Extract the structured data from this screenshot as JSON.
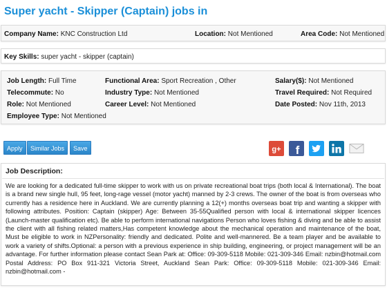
{
  "page_title": "Super yacht - Skipper (Captain) jobs in",
  "company": {
    "name_label": "Company Name:",
    "name_value": "KNC Construction Ltd",
    "location_label": "Location:",
    "location_value": "Not Mentioned",
    "area_code_label": "Area Code:",
    "area_code_value": "Not Mentioned"
  },
  "skills": {
    "label": "Key Skills:",
    "value": "super yacht - skipper (captain)"
  },
  "details": {
    "job_length": {
      "label": "Job Length:",
      "value": "Full Time"
    },
    "functional_area": {
      "label": "Functional Area:",
      "value": "Sport Recreation , Other"
    },
    "salary": {
      "label": "Salary($):",
      "value": "Not Mentioned"
    },
    "telecommute": {
      "label": "Telecommute:",
      "value": "No"
    },
    "industry_type": {
      "label": "Industry Type:",
      "value": "Not Mentioned"
    },
    "travel_required": {
      "label": "Travel Required:",
      "value": "Not Required"
    },
    "role": {
      "label": "Role:",
      "value": "Not Mentioned"
    },
    "career_level": {
      "label": "Career Level:",
      "value": "Not Mentioned"
    },
    "date_posted": {
      "label": "Date Posted:",
      "value": "Nov 11th, 2013"
    },
    "employee_type": {
      "label": "Employee Type:",
      "value": "Not Mentioned"
    }
  },
  "toolbar": {
    "apply_label": "Apply",
    "similar_jobs_label": "Similar Jobs",
    "save_label": "Save",
    "share_icons": [
      "google-plus-icon",
      "facebook-icon",
      "twitter-icon",
      "linkedin-icon",
      "email-icon"
    ],
    "colors": {
      "button": "#2b86c9",
      "google_plus": "#dd4b39",
      "facebook": "#3b5998",
      "twitter": "#1da1f2",
      "linkedin": "#0e76a8",
      "email": "#c8c8c8"
    }
  },
  "description": {
    "title": "Job Description:",
    "text": "We are looking for a dedicated full-time skipper to work with us on private recreational boat trips (both local & International). The boat is a brand new single hull, 95 feet, long-rage vessel (motor yacht) manned by 2-3 crews. The owner of the boat is from overseas who currently has a residence here in Auckland. We are currently planning a 12(+) months overseas boat trip and wanting a skipper with following attributes. Position: Captain (skipper) Age: Between 35-55Qualified person with local & international skipper licences (Launch-master qualification etc). Be able to perform international navigations Person who loves fishing & diving and be able to assist the client with all fishing related matters,Has competent knowledge about the mechanical operation and maintenance of the boat, Must be eligible to work in NZPersonality: friendly and dedicated. Polite and well-mannered. Be a team player and be available to work a variety of shifts.Optional: a person with a previous experience in ship building, engineering, or project management will be an advantage. For further information please contact Sean Park at: Office: 09-309-5118 Mobile: 021-309-346 Email: nzbin@hotmail.com Postal Address: PO Box 911-321 Victoria Street, Auckland Sean Park: Office: 09-309-5118 Mobile: 021-309-346 Email: nzbin@hotmail.com -"
  },
  "accent_color": "#1a8fd8"
}
